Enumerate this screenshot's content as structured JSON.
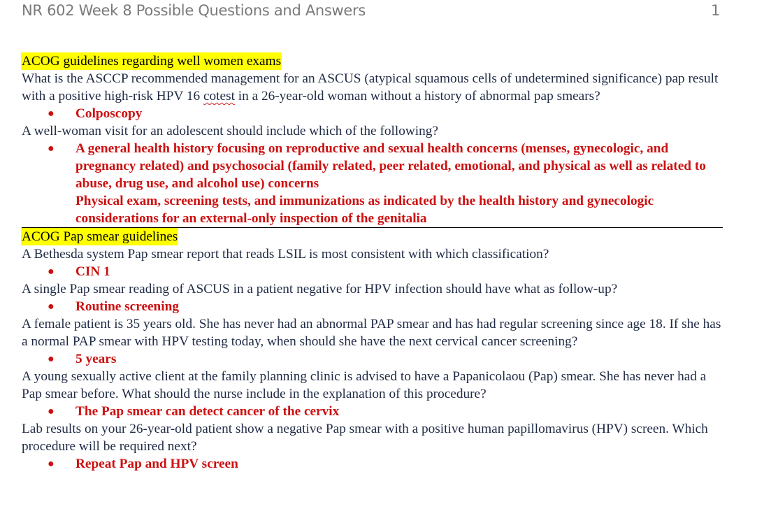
{
  "header": {
    "title": "NR 602 Week 8 Possible Questions and Answers",
    "page_number": "1"
  },
  "colors": {
    "question_text": "#1f2a44",
    "answer_text": "#cc1111",
    "highlight": "#ffff00",
    "header_text": "#7a7a7a"
  },
  "sections": [
    {
      "heading": "ACOG guidelines regarding well women exams",
      "items": [
        {
          "question_parts": {
            "before": "What is the ASCCP recommended management  for an ASCUS (atypical squamous cells of undetermined significance) pap result with a positive high-risk HPV 16 ",
            "misspelled": "cotest",
            "after": " in a 26-year-old woman without a history of abnormal pap smears?"
          },
          "answers": [
            "Colposcopy"
          ]
        },
        {
          "question": "A well-woman visit for an adolescent should include which of the following?",
          "answers": [
            "A general health history  focusing on reproductive  and sexual health  concerns (menses, gynecologic, and pregnancy related)  and psychosocial  (family related, peer related,  emotional,  and physical  as well as related to abuse,  drug  use,  and alcohol use)  concerns",
            "Physical exam,  screening  tests,  and immunizations  as indicated  by the health history  and gynecologic considerations  for an external-only  inspection  of the genitalia"
          ]
        }
      ]
    },
    {
      "heading": "ACOG Pap smear  guidelines",
      "items": [
        {
          "question": "A Bethesda system Pap smear report that reads LSIL  is most consistent with which classification?",
          "answers": [
            "CIN 1"
          ]
        },
        {
          "question": "A single Pap smear reading of ASCUS in a patient negative for HPV  infection should have what as follow-up?",
          "answers": [
            "Routine screening"
          ]
        },
        {
          "question": "A female patient is 35 years  old. She has never had an abnormal PAP smear  and has had regular  screening  since age 18. If she has a normal PAP  smear with HPV testing today, when should she have the next cervical  cancer screening?",
          "answers": [
            "5 years"
          ]
        },
        {
          "question": "A young sexually active client at the family planning clinic is advised to have a Papanicolaou (Pap) smear.  She has never had a Pap smear  before. What should the nurse include in the explanation of this procedure?",
          "answers": [
            "The Pap smear can detect cancer of the cervix"
          ]
        },
        {
          "question": "Lab results on your 26-year-old patient show a negative Pap smear  with a positive human papillomavirus (HPV) screen. Which procedure will be required next?",
          "answers": [
            "Repeat Pap and HPV screen"
          ]
        }
      ]
    }
  ]
}
